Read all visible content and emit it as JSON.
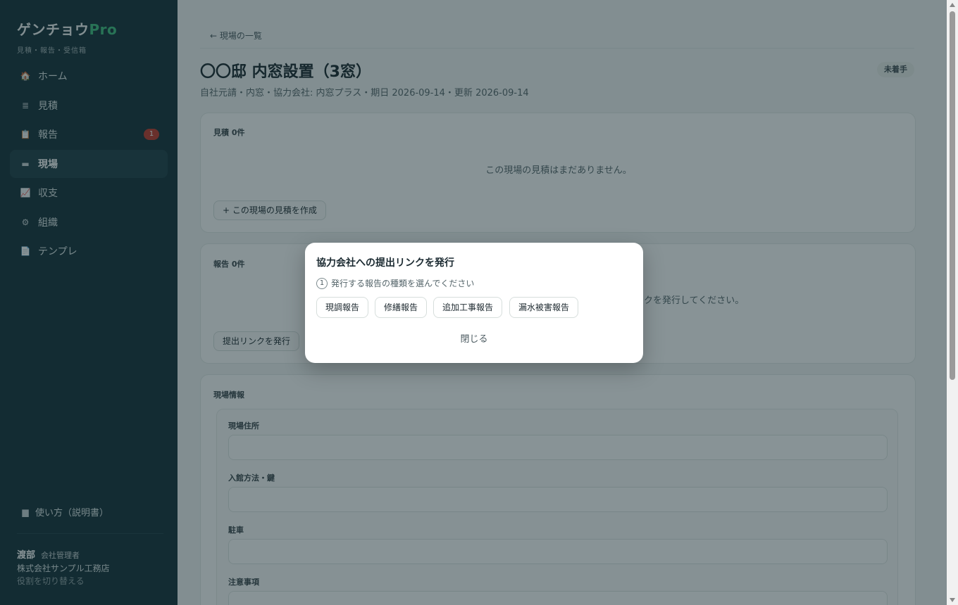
{
  "app": {
    "title_main": "ゲンチョウ",
    "title_accent": "Pro",
    "subtitle": "見積・報告・受信箱",
    "accent_color": "#3fbf7f"
  },
  "sidebar": {
    "items": [
      {
        "label": "ホーム",
        "icon": "home-icon",
        "glyph": "🏠",
        "badge": ""
      },
      {
        "label": "見積",
        "icon": "document-stack-icon",
        "glyph": "≣",
        "badge": ""
      },
      {
        "label": "報告",
        "icon": "clipboard-icon",
        "glyph": "📋",
        "badge": "1"
      },
      {
        "label": "現場",
        "icon": "folder-icon",
        "glyph": "▬",
        "badge": ""
      },
      {
        "label": "収支",
        "icon": "chart-up-icon",
        "glyph": "📈",
        "badge": ""
      },
      {
        "label": "組織",
        "icon": "gear-icon",
        "glyph": "⚙",
        "badge": ""
      },
      {
        "label": "テンプレ",
        "icon": "page-icon",
        "glyph": "📄",
        "badge": ""
      }
    ],
    "active": "現場",
    "help_label": "使い方（説明書）",
    "help_icon": "book-icon"
  },
  "user": {
    "name": "渡部",
    "role": "会社管理者",
    "company": "株式会社サンプル工務店",
    "switch_label": "役割を切り替える"
  },
  "page": {
    "back_link": "← 現場の一覧",
    "title": "〇〇邸 内窓設置（3窓）",
    "status": "未着手",
    "meta": "自社元請・内窓・協力会社: 内窓プラス・期日 2026-09-14・更新 2026-09-14"
  },
  "estimates": {
    "label": "見積 0件",
    "empty": "この現場の見積はまだありません。",
    "create_button": "+ この現場の見積を作成"
  },
  "reports": {
    "label": "報告 0件",
    "empty_visible": "クを発行してください。",
    "issue_button": "提出リンクを発行"
  },
  "site_info": {
    "label": "現場情報",
    "fields": [
      {
        "label": "現場住所",
        "value": ""
      },
      {
        "label": "入館方法・鍵",
        "value": ""
      },
      {
        "label": "駐車",
        "value": ""
      },
      {
        "label": "注意事項",
        "value": ""
      }
    ]
  },
  "modal": {
    "title": "協力会社への提出リンクを発行",
    "step_number": "1",
    "step_text": "発行する報告の種類を選んでください",
    "types": [
      "現調報告",
      "修繕報告",
      "追加工事報告",
      "漏水被害報告"
    ],
    "close_label": "閉じる"
  }
}
